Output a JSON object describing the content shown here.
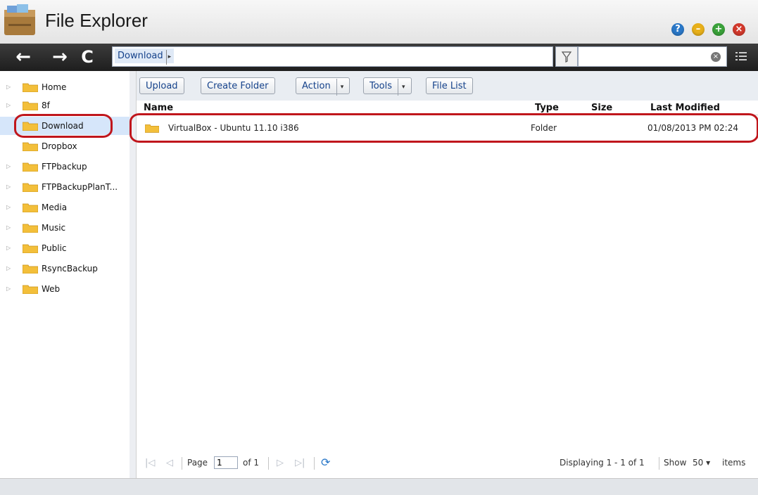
{
  "window": {
    "title": "File Explorer",
    "controls": [
      "help",
      "minimize",
      "maximize",
      "close"
    ],
    "control_colors": {
      "help": "#2a78c8",
      "minimize": "#e8b01a",
      "maximize": "#3aa23a",
      "close": "#d2392c"
    }
  },
  "toolbar": {
    "path_segment": "Download",
    "search_value": ""
  },
  "sidebar": {
    "items": [
      {
        "label": "Home",
        "expandable": true
      },
      {
        "label": "8f",
        "expandable": true
      },
      {
        "label": "Download",
        "expandable": false,
        "selected": true
      },
      {
        "label": "Dropbox",
        "expandable": false
      },
      {
        "label": "FTPbackup",
        "expandable": true
      },
      {
        "label": "FTPBackupPlanT...",
        "expandable": true
      },
      {
        "label": "Media",
        "expandable": true
      },
      {
        "label": "Music",
        "expandable": true
      },
      {
        "label": "Public",
        "expandable": true
      },
      {
        "label": "RsyncBackup",
        "expandable": true
      },
      {
        "label": "Web",
        "expandable": true
      }
    ]
  },
  "actions": {
    "upload": "Upload",
    "create_folder": "Create Folder",
    "action": "Action",
    "tools": "Tools",
    "file_list": "File List"
  },
  "table": {
    "columns": [
      "Name",
      "Type",
      "Size",
      "Last Modified"
    ],
    "rows": [
      {
        "name": "VirtualBox - Ubuntu 11.10 i386",
        "type": "Folder",
        "size": "",
        "modified": "01/08/2013 PM 02:24"
      }
    ]
  },
  "pager": {
    "page_label": "Page",
    "page_value": "1",
    "of_label": "of 1",
    "displaying": "Displaying 1 - 1 of 1",
    "show_label": "Show",
    "show_value": "50",
    "items_label": "items"
  },
  "highlight_color": "#c0161c"
}
